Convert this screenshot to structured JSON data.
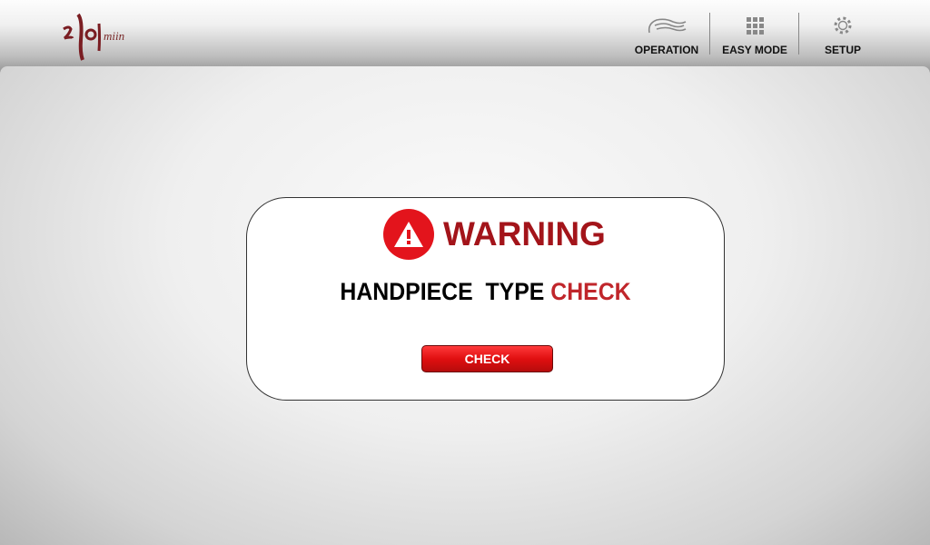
{
  "header": {
    "logo_text": "miin",
    "nav": [
      {
        "label": "OPERATION",
        "icon": "wave-icon"
      },
      {
        "label": "EASY MODE",
        "icon": "grid-icon"
      },
      {
        "label": "SETUP",
        "icon": "gear-icon"
      }
    ]
  },
  "dialog": {
    "title": "WARNING",
    "message_part1": "HANDPIECE  TYPE ",
    "message_part2": "CHECK",
    "button_label": "CHECK"
  },
  "colors": {
    "accent": "#e3141c",
    "title": "#a3141a"
  }
}
